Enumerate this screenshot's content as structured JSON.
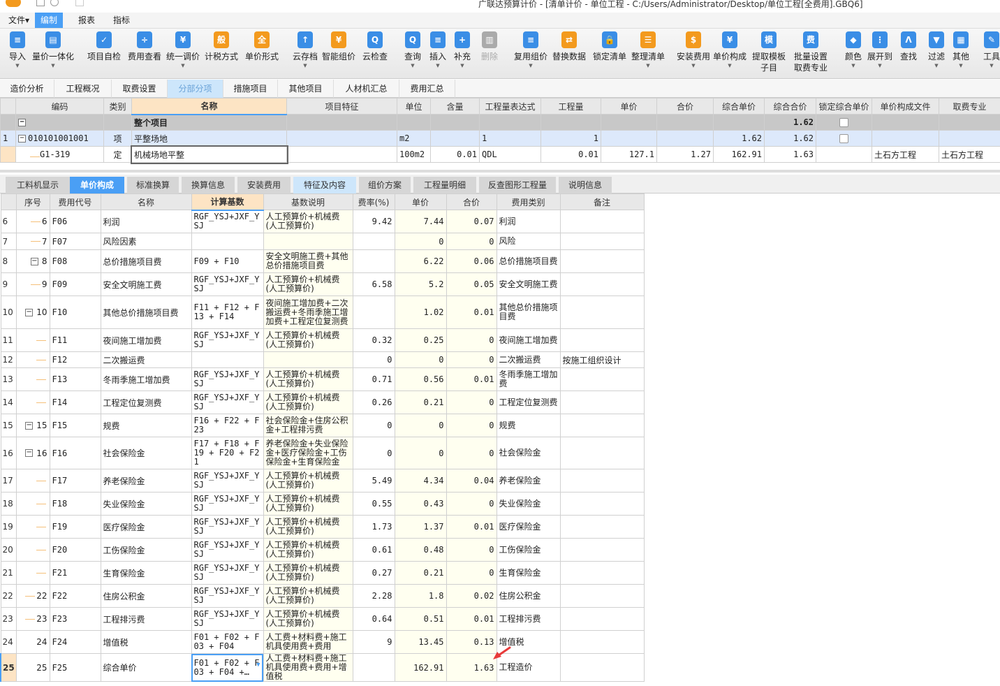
{
  "window": {
    "title": "广联达预算计价 - [清单计价 - 单位工程 - C:/Users/Administrator/Desktop/单位工程[全费用].GBQ6]"
  },
  "menu": [
    {
      "label": "文件▾"
    },
    {
      "label": "编制",
      "active": true
    },
    {
      "label": "报表"
    },
    {
      "label": "指标"
    }
  ],
  "toolbar": [
    {
      "label": "导入",
      "icon": "import-icon",
      "glyph": "≡",
      "color": "#3a8ee6",
      "dropdown": true
    },
    {
      "label": "量价一体化",
      "icon": "quantity-price-icon",
      "glyph": "▤",
      "color": "#3a8ee6",
      "dropdown": true
    },
    {
      "label": "项目自检",
      "icon": "self-check-icon",
      "glyph": "✓",
      "color": "#3a8ee6"
    },
    {
      "label": "费用查看",
      "icon": "fee-view-icon",
      "glyph": "÷",
      "color": "#3a8ee6"
    },
    {
      "label": "统一调价",
      "icon": "adjust-price-icon",
      "glyph": "¥",
      "color": "#3a8ee6",
      "dropdown": true
    },
    {
      "label": "计税方式",
      "icon": "tax-method-icon",
      "glyph": "般",
      "color": "#f39a1e"
    },
    {
      "label": "单价形式",
      "icon": "unit-price-form-icon",
      "glyph": "全",
      "color": "#f39a1e"
    },
    {
      "label": "云存档",
      "icon": "cloud-save-icon",
      "glyph": "↑",
      "color": "#3a8ee6",
      "dropdown": true
    },
    {
      "label": "智能组价",
      "icon": "smart-pricing-icon",
      "glyph": "¥",
      "color": "#f39a1e"
    },
    {
      "label": "云检查",
      "icon": "cloud-check-icon",
      "glyph": "Q",
      "color": "#3a8ee6"
    },
    {
      "label": "查询",
      "icon": "query-icon",
      "glyph": "Q",
      "color": "#3a8ee6",
      "dropdown": true
    },
    {
      "label": "插入",
      "icon": "insert-icon",
      "glyph": "≡",
      "color": "#3a8ee6",
      "dropdown": true
    },
    {
      "label": "补充",
      "icon": "supplement-icon",
      "glyph": "+",
      "color": "#3a8ee6",
      "dropdown": true
    },
    {
      "label": "删除",
      "icon": "delete-icon",
      "glyph": "▥",
      "color": "#aaaaaa",
      "disabled": true
    },
    {
      "label": "复用组价",
      "icon": "reuse-pricing-icon",
      "glyph": "≡",
      "color": "#3a8ee6",
      "dropdown": true
    },
    {
      "label": "替换数据",
      "icon": "replace-data-icon",
      "glyph": "⇄",
      "color": "#f39a1e"
    },
    {
      "label": "锁定清单",
      "icon": "lock-icon",
      "glyph": "🔒",
      "color": "#3a8ee6"
    },
    {
      "label": "整理清单",
      "icon": "organize-icon",
      "glyph": "☰",
      "color": "#f39a1e",
      "dropdown": true
    },
    {
      "label": "安装费用",
      "icon": "install-fee-icon",
      "glyph": "$",
      "color": "#f39a1e",
      "dropdown": true
    },
    {
      "label": "单价构成",
      "icon": "price-composition-icon",
      "glyph": "¥",
      "color": "#3a8ee6",
      "dropdown": true
    },
    {
      "label": "提取模板\n子目",
      "icon": "template-icon",
      "glyph": "模",
      "color": "#3a8ee6"
    },
    {
      "label": "批量设置\n取费专业",
      "icon": "batch-fee-icon",
      "glyph": "费",
      "color": "#3a8ee6"
    },
    {
      "label": "颜色",
      "icon": "color-icon",
      "glyph": "◆",
      "color": "#3a8ee6",
      "dropdown": true
    },
    {
      "label": "展开到",
      "icon": "expand-icon",
      "glyph": "⋮",
      "color": "#3a8ee6",
      "dropdown": true
    },
    {
      "label": "查找",
      "icon": "find-icon",
      "glyph": "Λ",
      "color": "#3a8ee6"
    },
    {
      "label": "过滤",
      "icon": "filter-icon",
      "glyph": "▼",
      "color": "#3a8ee6",
      "dropdown": true
    },
    {
      "label": "其他",
      "icon": "other-icon",
      "glyph": "▦",
      "color": "#3a8ee6",
      "dropdown": true
    },
    {
      "label": "工具",
      "icon": "tools-icon",
      "glyph": "✎",
      "color": "#3a8ee6",
      "dropdown": true
    }
  ],
  "page_tabs": [
    {
      "label": "造价分析"
    },
    {
      "label": "工程概况"
    },
    {
      "label": "取费设置"
    },
    {
      "label": "分部分项",
      "active": true
    },
    {
      "label": "措施项目"
    },
    {
      "label": "其他项目"
    },
    {
      "label": "人材机汇总"
    },
    {
      "label": "费用汇总"
    }
  ],
  "top_table": {
    "headers": [
      "",
      "编码",
      "类别",
      "名称",
      "项目特征",
      "单位",
      "含量",
      "工程量表达式",
      "工程量",
      "单价",
      "合价",
      "综合单价",
      "综合合价",
      "锁定综合单价",
      "单价构成文件",
      "取费专业"
    ],
    "rows": [
      {
        "type": "all",
        "cells": [
          "",
          "",
          "",
          "整个项目",
          "",
          "",
          "",
          "",
          "",
          "",
          "",
          "",
          "1.62",
          "",
          "",
          ""
        ],
        "lock": false
      },
      {
        "type": "item",
        "cells": [
          "1",
          "010101001001",
          "项",
          "平整场地",
          "",
          "m2",
          "",
          "1",
          "1",
          "",
          "",
          "1.62",
          "1.62",
          "",
          "",
          ""
        ],
        "lock": false
      },
      {
        "type": "sub",
        "cells": [
          "",
          "G1-319",
          "定",
          "机械场地平整",
          "",
          "100m2",
          "0.01",
          "QDL",
          "0.01",
          "127.1",
          "1.27",
          "162.91",
          "1.63",
          "",
          "土石方工程",
          "土石方工程"
        ]
      }
    ]
  },
  "bottom_tabs": [
    {
      "label": "工料机显示"
    },
    {
      "label": "单价构成",
      "active": true
    },
    {
      "label": "标准换算"
    },
    {
      "label": "换算信息"
    },
    {
      "label": "安装费用"
    },
    {
      "label": "特征及内容",
      "feat": true
    },
    {
      "label": "组价方案"
    },
    {
      "label": "工程量明细"
    },
    {
      "label": "反查图形工程量"
    },
    {
      "label": "说明信息"
    }
  ],
  "bottom_table": {
    "headers": [
      "",
      "序号",
      "费用代号",
      "名称",
      "计算基数",
      "基数说明",
      "费率(%)",
      "单价",
      "合价",
      "费用类别",
      "备注"
    ],
    "rows": [
      {
        "rn": "6",
        "seq": "6",
        "code": "F06",
        "name": "利润",
        "base": "RGF_YSJ+JXF_YSJ",
        "desc": "人工预算价+机械费(人工预算价)",
        "rate": "9.42",
        "price": "7.44",
        "total": "0.07",
        "cat": "利润",
        "note": ""
      },
      {
        "rn": "7",
        "seq": "7",
        "code": "F07",
        "name": "风险因素",
        "base": "",
        "desc": "",
        "rate": "",
        "price": "0",
        "total": "0",
        "cat": "风险",
        "note": ""
      },
      {
        "rn": "8",
        "seq": "8",
        "code": "F08",
        "name": "总价措施项目费",
        "base": "F09 + F10",
        "desc": "安全文明施工费+其他总价措施项目费",
        "rate": "",
        "price": "6.22",
        "total": "0.06",
        "cat": "总价措施项目费",
        "note": "",
        "exp": true
      },
      {
        "rn": "9",
        "seq": "9",
        "code": "F09",
        "name": "安全文明施工费",
        "base": "RGF_YSJ+JXF_YSJ",
        "desc": "人工预算价+机械费(人工预算价)",
        "rate": "6.58",
        "price": "5.2",
        "total": "0.05",
        "cat": "安全文明施工费",
        "note": ""
      },
      {
        "rn": "10",
        "seq": "10",
        "code": "F10",
        "name": "其他总价措施项目费",
        "base": "F11 + F12 + F13 + F14",
        "desc": "夜间施工增加费+二次搬运费+冬雨季施工增加费+工程定位复测费",
        "rate": "",
        "price": "1.02",
        "total": "0.01",
        "cat": "其他总价措施项目费",
        "note": "",
        "exp": true
      },
      {
        "rn": "11",
        "seq": "",
        "code": "F11",
        "name": "夜间施工增加费",
        "base": "RGF_YSJ+JXF_YSJ",
        "desc": "人工预算价+机械费(人工预算价)",
        "rate": "0.32",
        "price": "0.25",
        "total": "0",
        "cat": "夜间施工增加费",
        "note": ""
      },
      {
        "rn": "12",
        "seq": "",
        "code": "F12",
        "name": "二次搬运费",
        "base": "",
        "desc": "",
        "rate": "0",
        "price": "0",
        "total": "0",
        "cat": "二次搬运费",
        "note": "按施工组织设计"
      },
      {
        "rn": "13",
        "seq": "",
        "code": "F13",
        "name": "冬雨季施工增加费",
        "base": "RGF_YSJ+JXF_YSJ",
        "desc": "人工预算价+机械费(人工预算价)",
        "rate": "0.71",
        "price": "0.56",
        "total": "0.01",
        "cat": "冬雨季施工增加费",
        "note": ""
      },
      {
        "rn": "14",
        "seq": "",
        "code": "F14",
        "name": "工程定位复测费",
        "base": "RGF_YSJ+JXF_YSJ",
        "desc": "人工预算价+机械费(人工预算价)",
        "rate": "0.26",
        "price": "0.21",
        "total": "0",
        "cat": "工程定位复测费",
        "note": ""
      },
      {
        "rn": "15",
        "seq": "15",
        "code": "F15",
        "name": "规费",
        "base": "F16 + F22 + F23",
        "desc": "社会保险金+住房公积金+工程排污费",
        "rate": "0",
        "price": "0",
        "total": "0",
        "cat": "规费",
        "note": "",
        "exp": true
      },
      {
        "rn": "16",
        "seq": "16",
        "code": "F16",
        "name": "社会保险金",
        "base": "F17 + F18 + F19 + F20 + F21",
        "desc": "养老保险金+失业保险金+医疗保险金+工伤保险金+生育保险金",
        "rate": "0",
        "price": "0",
        "total": "0",
        "cat": "社会保险金",
        "note": "",
        "exp": true
      },
      {
        "rn": "17",
        "seq": "",
        "code": "F17",
        "name": "养老保险金",
        "base": "RGF_YSJ+JXF_YSJ",
        "desc": "人工预算价+机械费(人工预算价)",
        "rate": "5.49",
        "price": "4.34",
        "total": "0.04",
        "cat": "养老保险金",
        "note": ""
      },
      {
        "rn": "18",
        "seq": "",
        "code": "F18",
        "name": "失业保险金",
        "base": "RGF_YSJ+JXF_YSJ",
        "desc": "人工预算价+机械费(人工预算价)",
        "rate": "0.55",
        "price": "0.43",
        "total": "0",
        "cat": "失业保险金",
        "note": ""
      },
      {
        "rn": "19",
        "seq": "",
        "code": "F19",
        "name": "医疗保险金",
        "base": "RGF_YSJ+JXF_YSJ",
        "desc": "人工预算价+机械费(人工预算价)",
        "rate": "1.73",
        "price": "1.37",
        "total": "0.01",
        "cat": "医疗保险金",
        "note": ""
      },
      {
        "rn": "20",
        "seq": "",
        "code": "F20",
        "name": "工伤保险金",
        "base": "RGF_YSJ+JXF_YSJ",
        "desc": "人工预算价+机械费(人工预算价)",
        "rate": "0.61",
        "price": "0.48",
        "total": "0",
        "cat": "工伤保险金",
        "note": ""
      },
      {
        "rn": "21",
        "seq": "",
        "code": "F21",
        "name": "生育保险金",
        "base": "RGF_YSJ+JXF_YSJ",
        "desc": "人工预算价+机械费(人工预算价)",
        "rate": "0.27",
        "price": "0.21",
        "total": "0",
        "cat": "生育保险金",
        "note": ""
      },
      {
        "rn": "22",
        "seq": "22",
        "code": "F22",
        "name": "住房公积金",
        "base": "RGF_YSJ+JXF_YSJ",
        "desc": "人工预算价+机械费(人工预算价)",
        "rate": "2.28",
        "price": "1.8",
        "total": "0.02",
        "cat": "住房公积金",
        "note": ""
      },
      {
        "rn": "23",
        "seq": "23",
        "code": "F23",
        "name": "工程排污费",
        "base": "RGF_YSJ+JXF_YSJ",
        "desc": "人工预算价+机械费(人工预算价)",
        "rate": "0.64",
        "price": "0.51",
        "total": "0.01",
        "cat": "工程排污费",
        "note": ""
      },
      {
        "rn": "24",
        "seq": "24",
        "code": "F24",
        "name": "增值税",
        "base": "F01 + F02 + F03 + F04",
        "desc": "人工费+材料费+施工机具使用费+费用",
        "rate": "9",
        "price": "13.45",
        "total": "0.13",
        "cat": "增值税",
        "note": ""
      },
      {
        "rn": "25",
        "seq": "25",
        "code": "F25",
        "name": "综合单价",
        "base": "F01 + F02 + F03 + F04 +…",
        "desc": "人工费+材料费+施工机具使用费+费用+增值税",
        "rate": "",
        "price": "162.91",
        "total": "1.63",
        "cat": "工程造价",
        "note": "",
        "current": true
      }
    ]
  },
  "colors": {
    "accent": "#4a9ff5",
    "header_highlight": "#fde4c4",
    "annotation_arrow": "#e83a3a"
  }
}
